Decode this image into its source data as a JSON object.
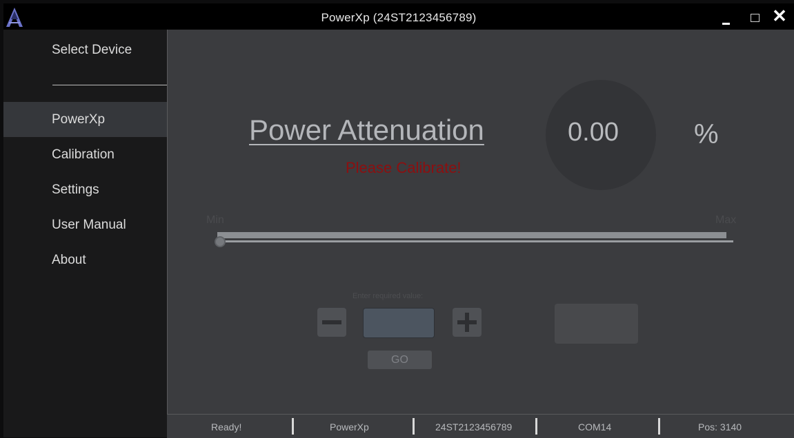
{
  "window": {
    "title": "PowerXp (24ST2123456789)",
    "logo_icon": "app-logo-icon",
    "controls": [
      "minimize-icon",
      "maximize-icon",
      "close-icon"
    ],
    "close_glyph": "✕"
  },
  "sidebar": {
    "select_device": "Select Device",
    "items": [
      {
        "label": "PowerXp",
        "active": true
      },
      {
        "label": "Calibration",
        "active": false
      },
      {
        "label": "Settings",
        "active": false
      },
      {
        "label": "User Manual",
        "active": false
      },
      {
        "label": "About",
        "active": false
      }
    ]
  },
  "main": {
    "heading": "Power Attenuation",
    "value": "0.00",
    "unit": "%",
    "warning": "Please Calibrate!",
    "slider": {
      "min_label": "Min",
      "max_label": "Max",
      "value": 0
    },
    "input_label": "Enter required value:",
    "input_value": "",
    "go_label": "GO",
    "apply_label": ""
  },
  "statusbar": {
    "items": [
      "Ready!",
      "PowerXp",
      "24ST2123456789",
      "COM14",
      "Pos: 3140"
    ]
  },
  "colors": {
    "main_bg": "#3b3c3f",
    "sidebar_bg": "#19191a",
    "active_item": "#35373b",
    "warning": "#8c0f10",
    "titlebar": "#000000"
  }
}
